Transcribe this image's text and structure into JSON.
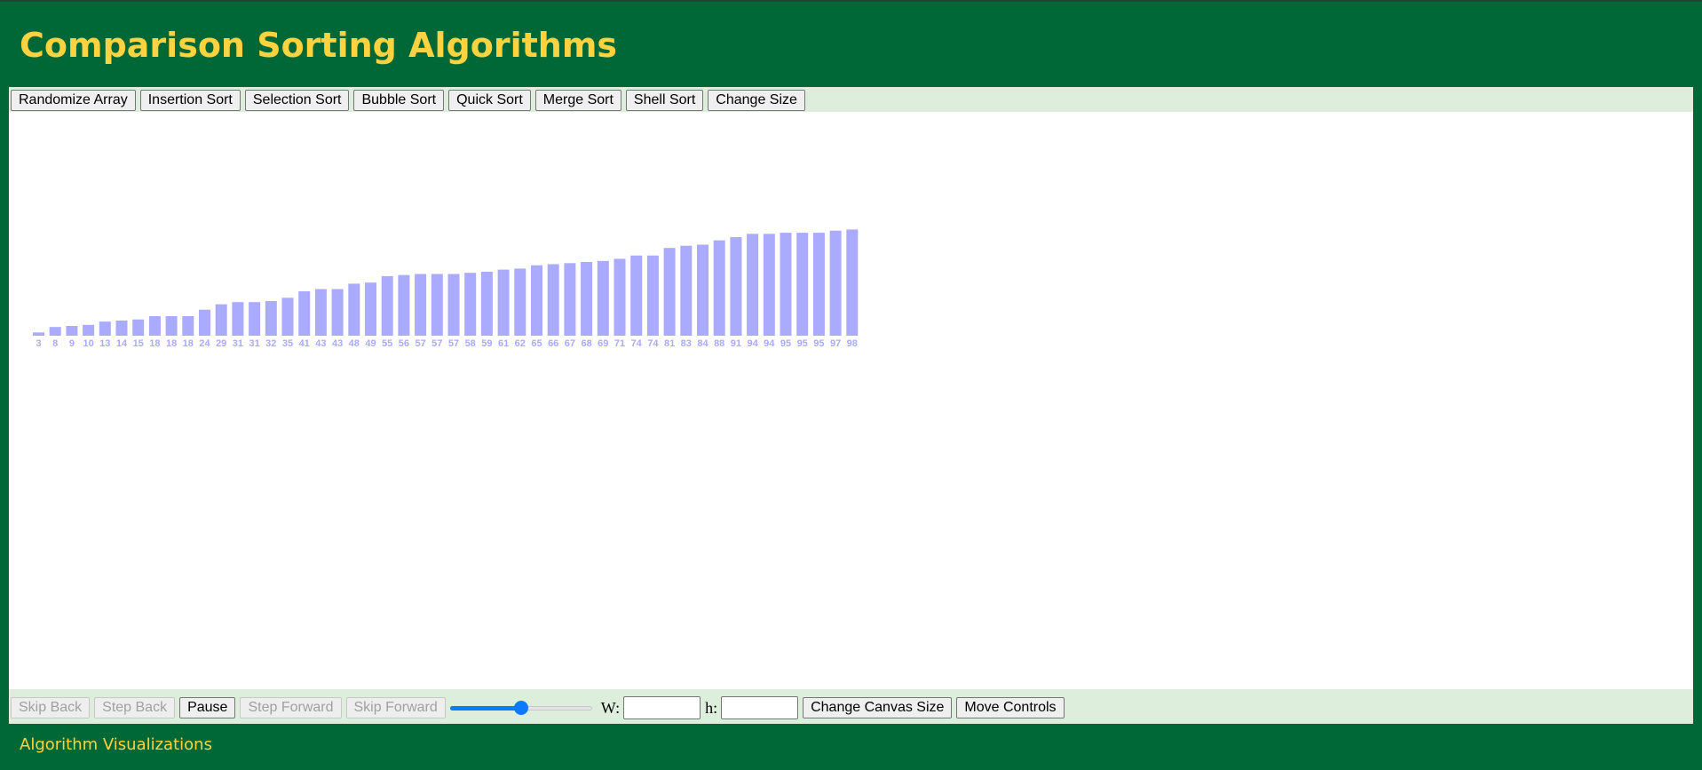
{
  "app": {
    "title": "Comparison Sorting Algorithms",
    "footer_link": "Algorithm Visualizations"
  },
  "colors": {
    "background": "#006837",
    "title": "#FFD33F",
    "toolbar_bg": "#DDEEDD",
    "bar": "#AAAAFF",
    "slider_accent": "#0A7AFF"
  },
  "toolbar": {
    "buttons": [
      "Randomize Array",
      "Insertion Sort",
      "Selection Sort",
      "Bubble Sort",
      "Quick Sort",
      "Merge Sort",
      "Shell Sort",
      "Change Size"
    ]
  },
  "visualization": {
    "values": [
      3,
      8,
      9,
      10,
      13,
      14,
      15,
      18,
      18,
      18,
      24,
      29,
      31,
      31,
      32,
      35,
      41,
      43,
      43,
      48,
      49,
      55,
      56,
      57,
      57,
      57,
      58,
      59,
      61,
      62,
      65,
      66,
      67,
      68,
      69,
      71,
      74,
      74,
      81,
      83,
      84,
      88,
      91,
      94,
      94,
      95,
      95,
      95,
      97,
      98
    ]
  },
  "controls": {
    "skip_back": "Skip Back",
    "step_back": "Step Back",
    "pause": "Pause",
    "step_forward": "Step Forward",
    "skip_forward": "Skip Forward",
    "speed_level": 0.5,
    "width_label": "W:",
    "height_label": "h:",
    "width_value": "",
    "height_value": "",
    "change_canvas_size": "Change Canvas Size",
    "move_controls": "Move Controls"
  }
}
